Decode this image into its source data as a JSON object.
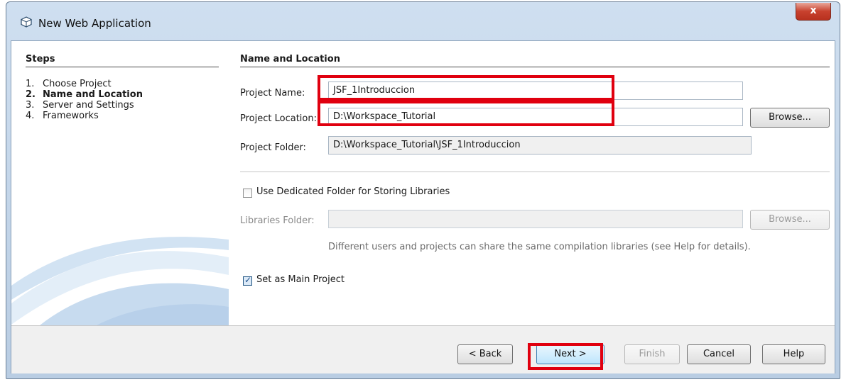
{
  "window": {
    "title": "New Web Application",
    "close_label": "x",
    "close_icon": "close-icon",
    "app_icon": "netbeans-cube-icon"
  },
  "steps": {
    "title": "Steps",
    "items": [
      {
        "num": "1.",
        "label": "Choose Project"
      },
      {
        "num": "2.",
        "label": "Name and Location"
      },
      {
        "num": "3.",
        "label": "Server and Settings"
      },
      {
        "num": "4.",
        "label": "Frameworks"
      }
    ]
  },
  "main": {
    "title": "Name and Location",
    "project_name": {
      "label": "Project Name:",
      "value": "JSF_1Introduccion"
    },
    "project_location": {
      "label": "Project Location:",
      "value": "D:\\Workspace_Tutorial",
      "browse": "Browse..."
    },
    "project_folder": {
      "label": "Project Folder:",
      "value": "D:\\Workspace_Tutorial\\JSF_1Introduccion"
    },
    "dedicated_folder": {
      "label": "Use Dedicated Folder for Storing Libraries",
      "checked": false
    },
    "libraries_folder": {
      "label": "Libraries Folder:",
      "value": "",
      "browse": "Browse..."
    },
    "hint": "Different users and projects can share the same compilation libraries (see Help for details).",
    "main_project": {
      "label": "Set as Main Project",
      "checked": true
    }
  },
  "buttons": {
    "back": "< Back",
    "next": "Next >",
    "finish": "Finish",
    "cancel": "Cancel",
    "help": "Help"
  },
  "colors": {
    "highlight": "#e0000f",
    "accent": "#3c7fb1"
  }
}
